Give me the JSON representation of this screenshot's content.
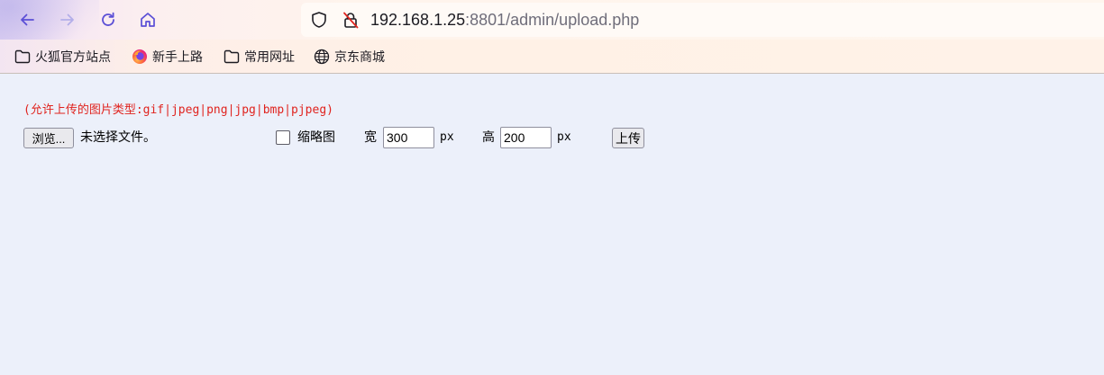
{
  "toolbar": {
    "back_icon": "back-arrow-icon",
    "forward_icon": "forward-arrow-icon",
    "reload_icon": "reload-icon",
    "home_icon": "home-icon"
  },
  "urlbar": {
    "host": "192.168.1.25",
    "rest": ":8801/admin/upload.php",
    "shield_icon": "shield-icon",
    "insecure_icon": "insecure-lock-icon"
  },
  "bookmarks": [
    {
      "label": "火狐官方站点",
      "icon": "folder-icon"
    },
    {
      "label": "新手上路",
      "icon": "firefox-icon"
    },
    {
      "label": "常用网址",
      "icon": "folder-icon"
    },
    {
      "label": "京东商城",
      "icon": "globe-icon"
    }
  ],
  "form": {
    "hint": "(允许上传的图片类型:gif|jpeg|png|jpg|bmp|pjpeg)",
    "browse_label": "浏览...",
    "no_file_text": "未选择文件。",
    "thumbnail_label": "缩略图",
    "thumbnail_checked": false,
    "width_label": "宽",
    "width_value": "300",
    "width_unit": "px",
    "height_label": "高",
    "height_value": "200",
    "height_unit": "px",
    "upload_label": "上传"
  },
  "colors": {
    "hint_text": "#e0241f",
    "page_background": "#ecf0fa",
    "nav_icon": "#5b4fd6"
  }
}
